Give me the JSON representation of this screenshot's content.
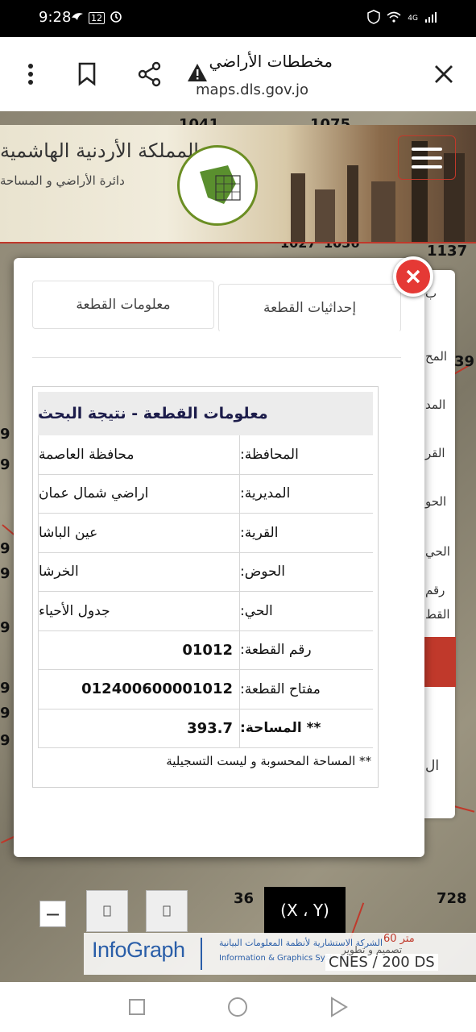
{
  "statusbar": {
    "time": "9:28",
    "battery": "12",
    "signal": "4G"
  },
  "browser": {
    "title": "مخططات الأراضي",
    "url": "maps.dls.gov.jo"
  },
  "banner": {
    "title": "المملكة الأردنية الهاشمية",
    "subtitle": "دائرة الأراضي و المساحة"
  },
  "map": {
    "numbers": [
      "1041",
      "1075",
      "1027",
      "1036",
      "1137",
      "39",
      "9",
      "9",
      "9",
      "9",
      "9",
      "9",
      "9",
      "9",
      "36",
      "728"
    ]
  },
  "background_panel": {
    "labels": [
      "المح",
      "المد",
      "القر",
      "الحو",
      "الحي",
      "رقم",
      "القط",
      "ال",
      "ب"
    ]
  },
  "dialog": {
    "tab_info": "معلومات القطعة",
    "tab_coords": "إحداثيات القطعة",
    "result_title": "معلومات القطعة - نتيجة البحث",
    "rows": [
      {
        "key": "المحافظة:",
        "value": "محافظة العاصمة"
      },
      {
        "key": "المديرية:",
        "value": "اراضي شمال عمان"
      },
      {
        "key": "القرية:",
        "value": "عين الباشا"
      },
      {
        "key": "الحوض:",
        "value": "الخرشا"
      },
      {
        "key": "الحي:",
        "value": "جدول الأحياء"
      },
      {
        "key": "رقم القطعة:",
        "value": "01012"
      },
      {
        "key": "مفتاح القطعة:",
        "value": "012400600001012"
      },
      {
        "key": "** المساحة:",
        "value": "393.7"
      }
    ],
    "note": "** المساحة المحسوبة و ليست التسجيلية"
  },
  "controls": {
    "zoom_minus": "−",
    "xy_label": "(X ، Y)",
    "infograph": "InfoGraph",
    "info_ar": "الشركة الاستشارية لأنظمة المعلومات البيانية",
    "info_en": "Information & Graphics System",
    "cnes": "CNES / 200",
    "scale_top": "متر 60",
    "scale_bottom": "تصميم و تطوير",
    "ds": "DS"
  }
}
